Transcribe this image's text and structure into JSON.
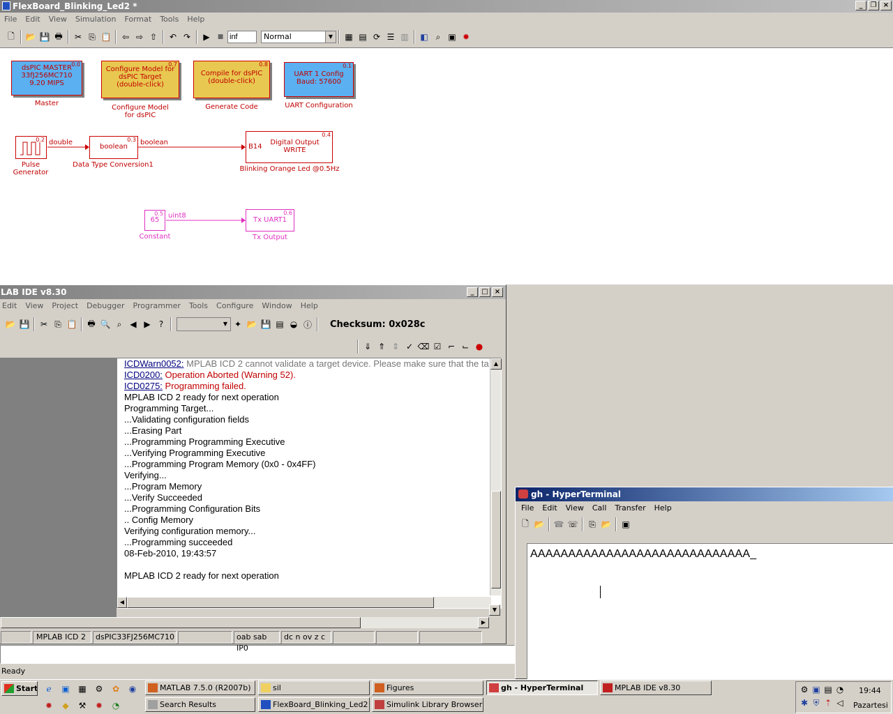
{
  "simulink": {
    "title": "FlexBoard_Blinking_Led2 *",
    "menu": [
      "File",
      "Edit",
      "View",
      "Simulation",
      "Format",
      "Tools",
      "Help"
    ],
    "stop_time": "inf",
    "sim_mode": "Normal",
    "blocks": {
      "master": {
        "lines": [
          "dsPIC MASTER",
          "33fJ256MC710",
          "9.20 MIPS"
        ],
        "num": "0.0",
        "label": "Master"
      },
      "config": {
        "lines": [
          "Configure Model for",
          "dsPIC Target",
          "(double-click)"
        ],
        "num": "0.7",
        "label1": "Configure Model",
        "label2": "for dsPIC"
      },
      "compile": {
        "lines": [
          "Compile for dsPIC",
          "(double-click)"
        ],
        "num": "0.8",
        "label": "Generate Code"
      },
      "uart": {
        "lines": [
          "UART 1 Config",
          "Baud: 57600"
        ],
        "num": "0.1",
        "label": "UART Configuration"
      },
      "pulse": {
        "num": "0.2",
        "label1": "Pulse",
        "label2": "Generator",
        "out": "double"
      },
      "dtc": {
        "text": "boolean",
        "num": "0.3",
        "label": "Data Type Conversion1",
        "out": "boolean"
      },
      "dout": {
        "pin": "B14",
        "lines": [
          "Digital Output",
          "WRITE"
        ],
        "num": "0.4",
        "label": "Blinking Orange Led @0.5Hz"
      },
      "const": {
        "text": "65",
        "num": "0.5",
        "label": "Constant",
        "out": "uint8"
      },
      "tx": {
        "text": "Tx UART1",
        "num": "0.6",
        "label": "Tx Output"
      }
    },
    "status": "Ready"
  },
  "mplab": {
    "title": "LAB IDE v8.30",
    "menu": [
      "Edit",
      "View",
      "Project",
      "Debugger",
      "Programmer",
      "Tools",
      "Configure",
      "Window",
      "Help"
    ],
    "checksum": "Checksum:  0x028c",
    "output": [
      {
        "link": "ICDWarn0052:",
        "text": " MPLAB ICD 2 cannot validate a target device. Please make sure that the ta",
        "cls": "gray"
      },
      {
        "link": "ICD0200:",
        "text": " Operation Aborted (Warning 52).",
        "cls": "red"
      },
      {
        "link": "ICD0275:",
        "text": "  Programming failed.",
        "cls": "red"
      },
      {
        "text": "MPLAB ICD 2 ready for next operation"
      },
      {
        "text": "Programming Target..."
      },
      {
        "text": "...Validating configuration fields"
      },
      {
        "text": "...Erasing Part"
      },
      {
        "text": "...Programming Programming Executive"
      },
      {
        "text": "...Verifying Programming Executive"
      },
      {
        "text": "...Programming Program Memory (0x0 - 0x4FF)"
      },
      {
        "text": "Verifying..."
      },
      {
        "text": "...Program Memory"
      },
      {
        "text": "...Verify Succeeded"
      },
      {
        "text": "...Programming Configuration Bits"
      },
      {
        "text": ".. Config Memory"
      },
      {
        "text": "Verifying configuration memory..."
      },
      {
        "text": "...Programming succeeded"
      },
      {
        "text": "08-Feb-2010, 19:43:57"
      },
      {
        "text": ""
      },
      {
        "text": "MPLAB ICD 2 ready for next operation"
      }
    ],
    "status": {
      "tool": "MPLAB ICD 2",
      "device": "dsPIC33FJ256MC710",
      "bits": "oab sab IP0",
      "flags": "dc n ov z c"
    }
  },
  "hyperterminal": {
    "title": "gh - HyperTerminal",
    "menu": [
      "File",
      "Edit",
      "View",
      "Call",
      "Transfer",
      "Help"
    ],
    "text": "AAAAAAAAAAAAAAAAAAAAAAAAAAAAA_"
  },
  "taskbar": {
    "start": "Start",
    "row1": [
      "MATLAB  7.5.0 (R2007b)",
      "sil",
      "Figures",
      "gh - HyperTerminal",
      "MPLAB IDE v8.30"
    ],
    "row2": [
      "Search Results",
      "FlexBoard_Blinking_Led2 *",
      "Simulink Library Browser"
    ],
    "time": "19:44",
    "day": "Pazartesi"
  }
}
